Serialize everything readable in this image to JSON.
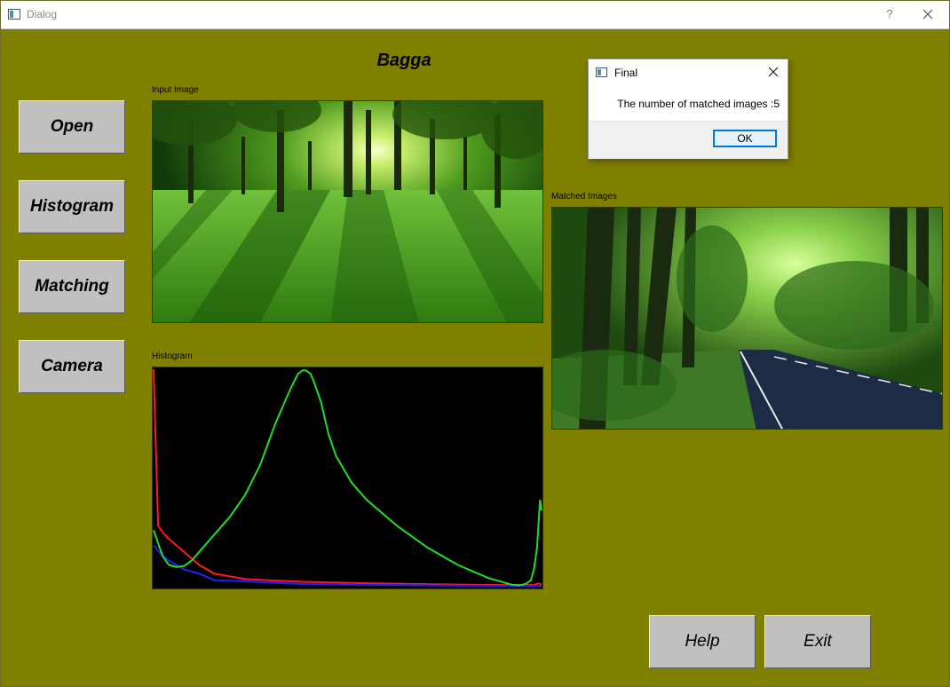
{
  "window": {
    "title": "Dialog",
    "help_glyph": "?"
  },
  "app": {
    "title": "Bagga"
  },
  "sidebar": {
    "buttons": [
      "Open",
      "Histogram",
      "Matching",
      "Camera"
    ]
  },
  "panels": {
    "input_caption": "Input Image",
    "histogram_caption": "Histogram",
    "matched_caption": "Matched Images"
  },
  "footer": {
    "help_label": "Help",
    "exit_label": "Exit"
  },
  "dialog": {
    "title": "Final",
    "message": "The number of matched images :5",
    "ok_label": "OK"
  },
  "icons": {
    "window": "app-window-icon",
    "help": "question-mark-icon",
    "close": "close-icon",
    "dialog": "dialog-window-icon",
    "dialog_close": "dialog-close-icon"
  },
  "colors": {
    "background": "#808000",
    "button": "#c0c0c0",
    "histogram_red": "#ff1a1a",
    "histogram_green": "#22dd22",
    "histogram_blue": "#2020ff",
    "ok_border": "#0078d7"
  },
  "chart_data": {
    "type": "line",
    "title": "Histogram",
    "x_range": [
      0,
      255
    ],
    "y_range": [
      0,
      100
    ],
    "series": [
      {
        "name": "",
        "color": "#ff1a1a",
        "x": [
          0,
          3,
          6,
          10,
          15,
          20,
          30,
          40,
          60,
          80,
          100,
          140,
          180,
          220,
          250,
          253,
          255
        ],
        "values": [
          100,
          28,
          25,
          22,
          19,
          16,
          10,
          6,
          3.5,
          2.8,
          2.2,
          1.6,
          1.2,
          0.8,
          0.8,
          1.5,
          0.8
        ]
      },
      {
        "name": "",
        "color": "#2020ff",
        "x": [
          0,
          5,
          10,
          15,
          20,
          30,
          40,
          60,
          80,
          100,
          150,
          200,
          255
        ],
        "values": [
          19,
          15,
          12,
          10,
          8,
          6,
          3,
          2.5,
          1.8,
          1.2,
          0.8,
          0.5,
          0.3
        ]
      },
      {
        "name": "",
        "color": "#22dd22",
        "x": [
          0,
          3,
          6,
          10,
          15,
          20,
          25,
          30,
          40,
          50,
          60,
          70,
          80,
          90,
          95,
          98,
          100,
          103,
          105,
          110,
          115,
          120,
          130,
          140,
          160,
          180,
          200,
          220,
          230,
          235,
          240,
          243,
          245,
          248,
          250,
          252,
          254,
          255
        ],
        "values": [
          26,
          20,
          14,
          10,
          9,
          9.5,
          12,
          16,
          24,
          32,
          42,
          56,
          75,
          91,
          98,
          99.5,
          99.5,
          98,
          95,
          85,
          70,
          60,
          48,
          40,
          28,
          18,
          10,
          4,
          2,
          1,
          0.6,
          1,
          1.5,
          3,
          8,
          18,
          40,
          35
        ]
      }
    ]
  }
}
